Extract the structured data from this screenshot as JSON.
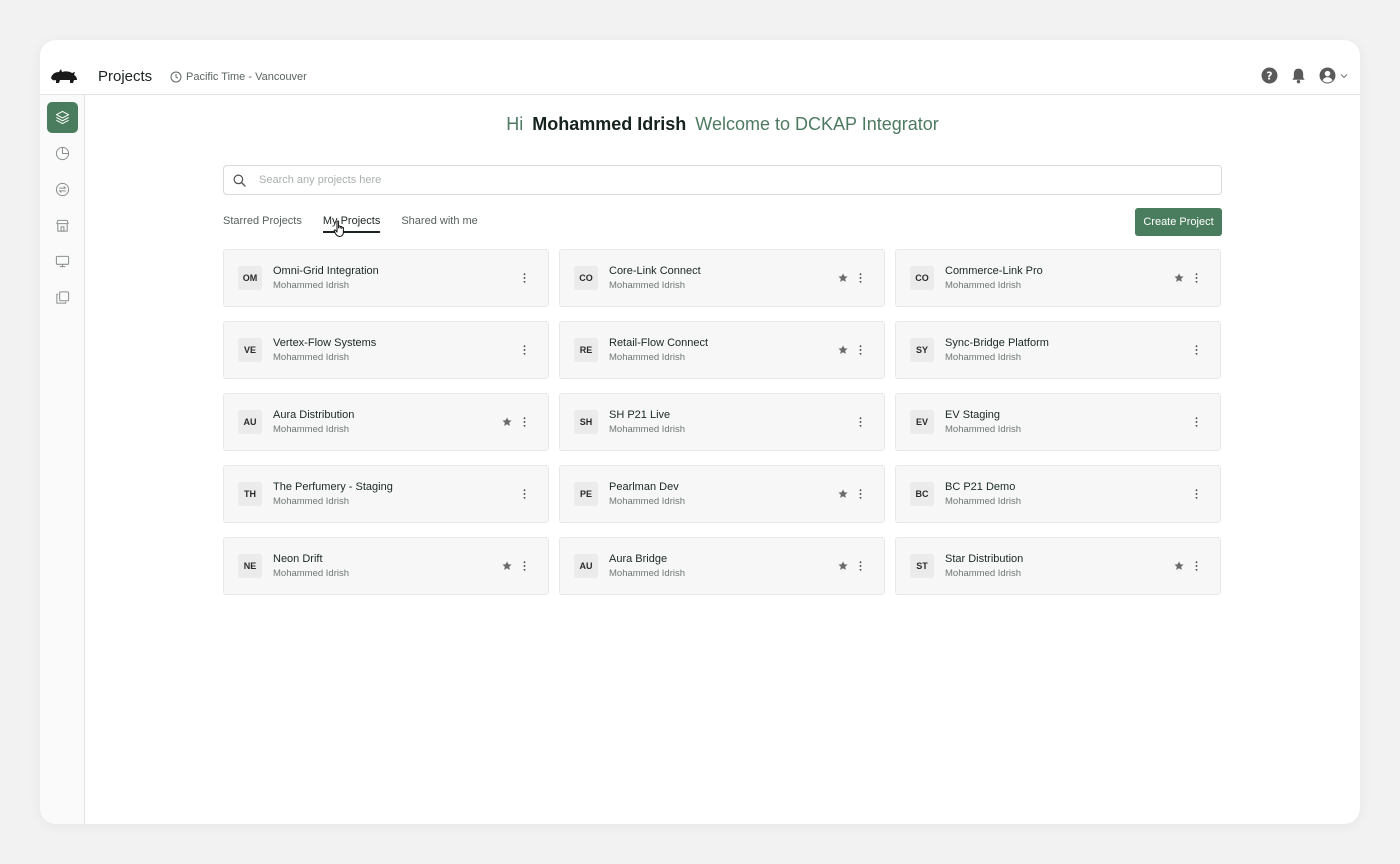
{
  "header": {
    "title": "Projects",
    "timezone": "Pacific Time - Vancouver"
  },
  "sidebar": {
    "items": [
      {
        "icon": "layers-icon",
        "active": true
      },
      {
        "icon": "pie-chart-icon",
        "active": false
      },
      {
        "icon": "sync-icon",
        "active": false
      },
      {
        "icon": "store-icon",
        "active": false
      },
      {
        "icon": "monitor-icon",
        "active": false
      },
      {
        "icon": "copy-icon",
        "active": false
      }
    ]
  },
  "welcome": {
    "greeting": "Hi",
    "user_name": "Mohammed Idrish",
    "message": "Welcome to DCKAP Integrator"
  },
  "search": {
    "placeholder": "Search any projects here",
    "value": ""
  },
  "tabs": [
    {
      "label": "Starred Projects",
      "active": false
    },
    {
      "label": "My Projects",
      "active": true
    },
    {
      "label": "Shared with me",
      "active": false
    }
  ],
  "create_button_label": "Create Project",
  "colors": {
    "accent": "#4a7c5e",
    "star": "#6b6b6b"
  },
  "projects": [
    {
      "initials": "OM",
      "name": "Omni-Grid Integration",
      "owner": "Mohammed Idrish",
      "starred": false
    },
    {
      "initials": "CO",
      "name": "Core-Link Connect",
      "owner": "Mohammed Idrish",
      "starred": true
    },
    {
      "initials": "CO",
      "name": "Commerce-Link Pro",
      "owner": "Mohammed Idrish",
      "starred": true
    },
    {
      "initials": "VE",
      "name": "Vertex-Flow Systems",
      "owner": "Mohammed Idrish",
      "starred": false
    },
    {
      "initials": "RE",
      "name": "Retail-Flow Connect",
      "owner": "Mohammed Idrish",
      "starred": true
    },
    {
      "initials": "SY",
      "name": "Sync-Bridge Platform",
      "owner": "Mohammed Idrish",
      "starred": false
    },
    {
      "initials": "AU",
      "name": "Aura Distribution",
      "owner": "Mohammed Idrish",
      "starred": true
    },
    {
      "initials": "SH",
      "name": "SH P21 Live",
      "owner": "Mohammed Idrish",
      "starred": false
    },
    {
      "initials": "EV",
      "name": "EV Staging",
      "owner": "Mohammed Idrish",
      "starred": false
    },
    {
      "initials": "TH",
      "name": "The Perfumery - Staging",
      "owner": "Mohammed Idrish",
      "starred": false
    },
    {
      "initials": "PE",
      "name": "Pearlman Dev",
      "owner": "Mohammed Idrish",
      "starred": true
    },
    {
      "initials": "BC",
      "name": "BC P21 Demo",
      "owner": "Mohammed Idrish",
      "starred": false
    },
    {
      "initials": "NE",
      "name": "Neon Drift",
      "owner": "Mohammed Idrish",
      "starred": true
    },
    {
      "initials": "AU",
      "name": "Aura Bridge",
      "owner": "Mohammed Idrish",
      "starred": true
    },
    {
      "initials": "ST",
      "name": "Star Distribution",
      "owner": "Mohammed Idrish",
      "starred": true
    }
  ]
}
